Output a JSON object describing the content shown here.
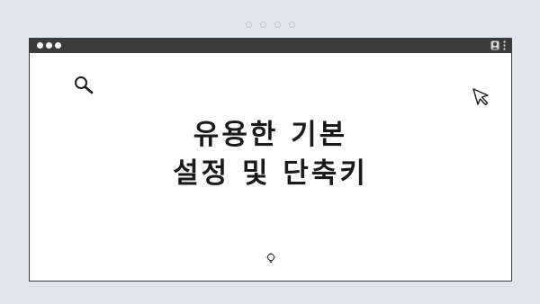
{
  "page_indicator": {
    "dots": 4
  },
  "window": {
    "titlebar": {
      "controls": [
        "dot",
        "dot",
        "dot"
      ],
      "right_icons": [
        "user-icon",
        "kebab-menu-icon"
      ]
    },
    "content": {
      "headline_line1": "유용한 기본",
      "headline_line2": "설정 및 단축키",
      "icons": [
        "search-icon",
        "cursor-icon",
        "lightbulb-icon"
      ]
    }
  },
  "colors": {
    "background": "#dfe6ee",
    "titlebar": "#3b3b3b",
    "window": "#ffffff",
    "text": "#1a1a1a"
  }
}
